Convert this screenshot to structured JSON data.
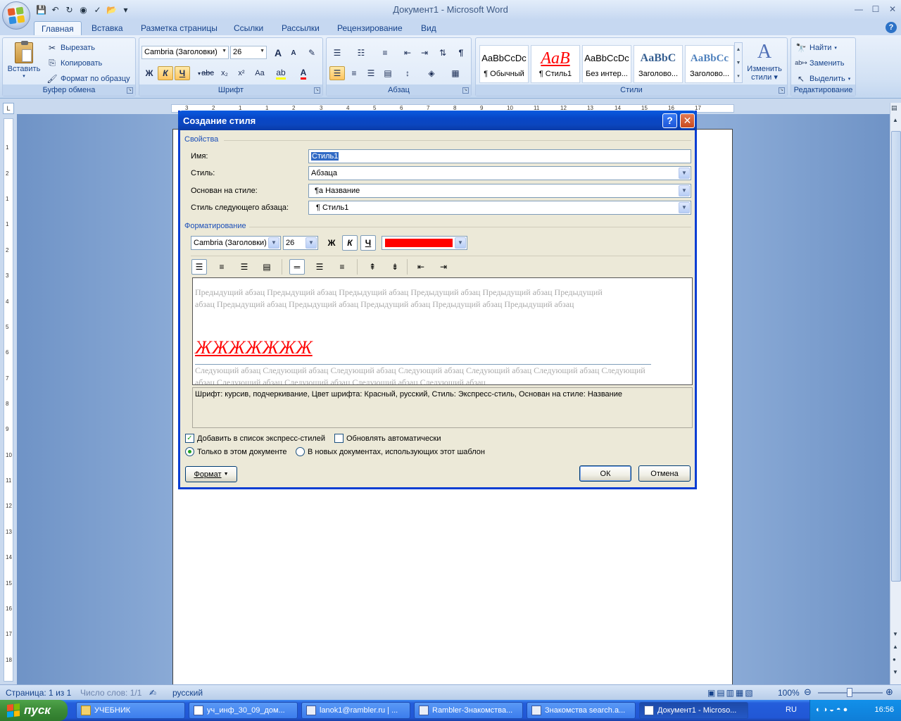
{
  "window": {
    "title": "Документ1 - Microsoft Word",
    "controls": {
      "minimize": "—",
      "maximize": "☐",
      "close": "✕"
    }
  },
  "quick_access": [
    "save-icon",
    "undo-icon",
    "redo-icon",
    "repeat-icon",
    "spelling-icon",
    "open-icon"
  ],
  "tabs": [
    {
      "label": "Главная",
      "active": true
    },
    {
      "label": "Вставка"
    },
    {
      "label": "Разметка страницы"
    },
    {
      "label": "Ссылки"
    },
    {
      "label": "Рассылки"
    },
    {
      "label": "Рецензирование"
    },
    {
      "label": "Вид"
    }
  ],
  "help_glyph": "?",
  "ribbon": {
    "clipboard": {
      "label": "Буфер обмена",
      "paste": "Вставить",
      "cut": "Вырезать",
      "copy": "Копировать",
      "format_painter": "Формат по образцу"
    },
    "font": {
      "label": "Шрифт",
      "font_name": "Cambria (Заголовки)",
      "font_size": "26",
      "bold": "Ж",
      "italic": "К",
      "underline": "Ч",
      "strike": "abc",
      "subscript": "x₂",
      "superscript": "x²",
      "change_case": "Aa",
      "grow": "A",
      "shrink": "A"
    },
    "paragraph": {
      "label": "Абзац"
    },
    "styles": {
      "label": "Стили",
      "items": [
        {
          "sample": "AaBbCcDc",
          "name": "¶ Обычный"
        },
        {
          "sample": "AaB",
          "name": "¶ Стиль1"
        },
        {
          "sample": "AaBbCcDc",
          "name": "Без интер..."
        },
        {
          "sample": "AaBbC",
          "name": "Заголово..."
        },
        {
          "sample": "AaBbCc",
          "name": "Заголово..."
        }
      ],
      "change_styles_line1": "Изменить",
      "change_styles_line2": "стили"
    },
    "editing": {
      "label": "Редактирование",
      "find": "Найти",
      "replace": "Заменить",
      "select": "Выделить"
    }
  },
  "ruler_marks": [
    "3",
    "2",
    "1",
    "1",
    "2",
    "3",
    "4",
    "5",
    "6",
    "7",
    "8",
    "9",
    "10",
    "11",
    "12",
    "13",
    "14",
    "15",
    "16",
    "17"
  ],
  "vruler_marks": [
    "1",
    "2",
    "1",
    "1",
    "2",
    "3",
    "4",
    "5",
    "6",
    "7",
    "8",
    "9",
    "10",
    "11",
    "12",
    "13",
    "14",
    "15",
    "16",
    "17",
    "18"
  ],
  "dialog": {
    "title": "Создание стиля",
    "help": "?",
    "close": "✕",
    "properties_title": "Свойства",
    "name_label": "Имя:",
    "name_value": "Стиль1",
    "style_type_label": "Стиль:",
    "style_type_value": "Абзаца",
    "based_on_label": "Основан на стиле:",
    "based_on_value": "¶a Название",
    "next_style_label": "Стиль следующего абзаца:",
    "next_style_value": "¶ Стиль1",
    "formatting_title": "Форматирование",
    "font_name": "Cambria (Заголовки)",
    "font_size": "26",
    "bold": "Ж",
    "italic": "К",
    "underline": "Ч",
    "font_color": "#ff0000",
    "preview_prev": "Предыдущий абзац Предыдущий абзац Предыдущий абзац Предыдущий абзац Предыдущий абзац Предыдущий абзац Предыдущий абзац Предыдущий абзац Предыдущий абзац Предыдущий абзац Предыдущий абзац",
    "preview_sample": "ЖЖЖЖЖЖЖ",
    "preview_next": "Следующий абзац Следующий абзац Следующий абзац Следующий абзац Следующий абзац Следующий абзац Следующий абзац Следующий абзац Следующий абзац Следующий абзац Следующий абзац",
    "description": "Шрифт: курсив, подчеркивание, Цвет шрифта: Красный, русский, Стиль: Экспресс-стиль, Основан на стиле: Название",
    "add_quick_styles": "Добавить в список экспресс-стилей",
    "add_quick_styles_checked": true,
    "auto_update": "Обновлять автоматически",
    "auto_update_checked": false,
    "only_this_doc": "Только в этом документе",
    "new_docs_template": "В новых документах, использующих этот шаблон",
    "format_button": "Формат",
    "ok": "ОК",
    "cancel": "Отмена"
  },
  "status": {
    "page": "Страница: 1 из 1",
    "words": "Число слов: 1/1",
    "language": "русский",
    "zoom": "100%"
  },
  "taskbar": {
    "start": "пуск",
    "tasks": [
      {
        "label": "УЧЕБНИК"
      },
      {
        "label": "уч_инф_30_09_дом..."
      },
      {
        "label": "lanok1@rambler.ru | ..."
      },
      {
        "label": "Rambler-Знакомства..."
      },
      {
        "label": "Знакомства search.a..."
      },
      {
        "label": "Документ1 - Microso...",
        "active": true
      }
    ],
    "lang": "RU",
    "clock": "16:56"
  }
}
